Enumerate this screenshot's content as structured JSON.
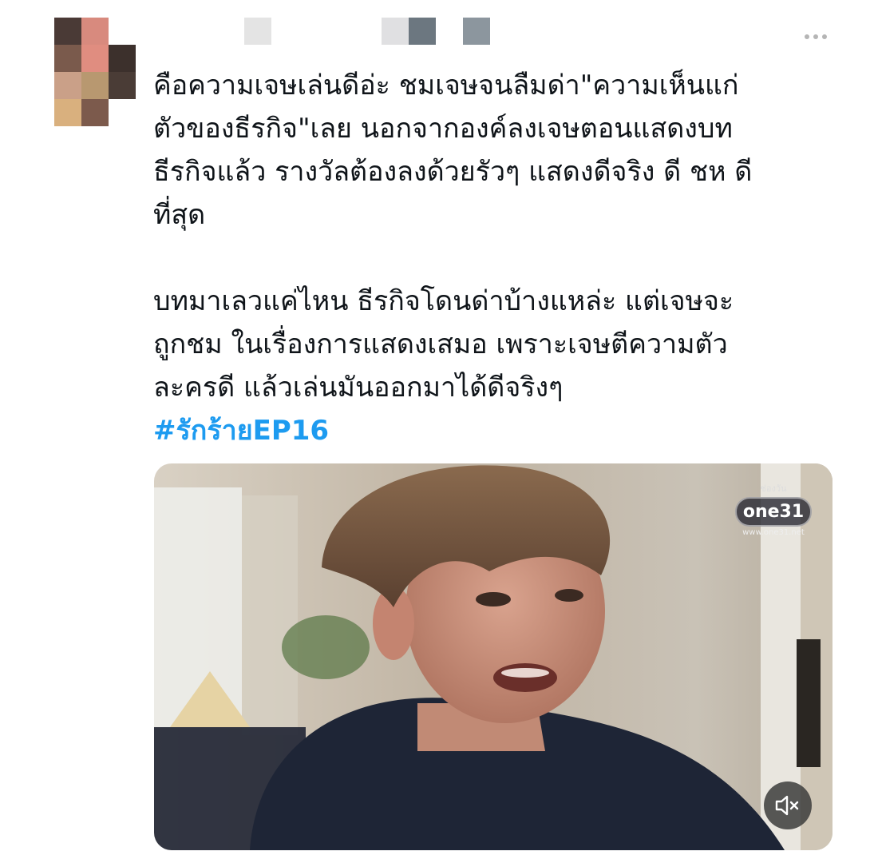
{
  "tweet": {
    "text": "คือความเจษเล่นดีอ่ะ ชมเจษจนลืมด่า\"ความเห็นแก่\nตัวของธีรกิจ\"เลย นอกจากองค์ลงเจษตอนแสดงบท\nธีรกิจแล้ว รางวัลต้องลงด้วยรัวๆ แสดงดีจริง ดี ชห ดี\nที่สุด\n\nบทมาเลวแค่ไหน ธีรกิจโดนด่าบ้างแหล่ะ แต่เจษจะ\nถูกชม ในเรื่องการแสดงเสมอ เพราะเจษตีความตัว\nละครดี แล้วเล่นมันออกมาได้ดีจริงๆ",
    "hashtag": "#รักร้ายEP16"
  },
  "media": {
    "watermark_top": "ช่องวัน",
    "watermark_logo": "one31",
    "watermark_url": "www.one31.net",
    "mute_icon": "speaker-muted-icon"
  },
  "colors": {
    "hashtag": "#1d9bf0",
    "text": "#0f1419"
  }
}
